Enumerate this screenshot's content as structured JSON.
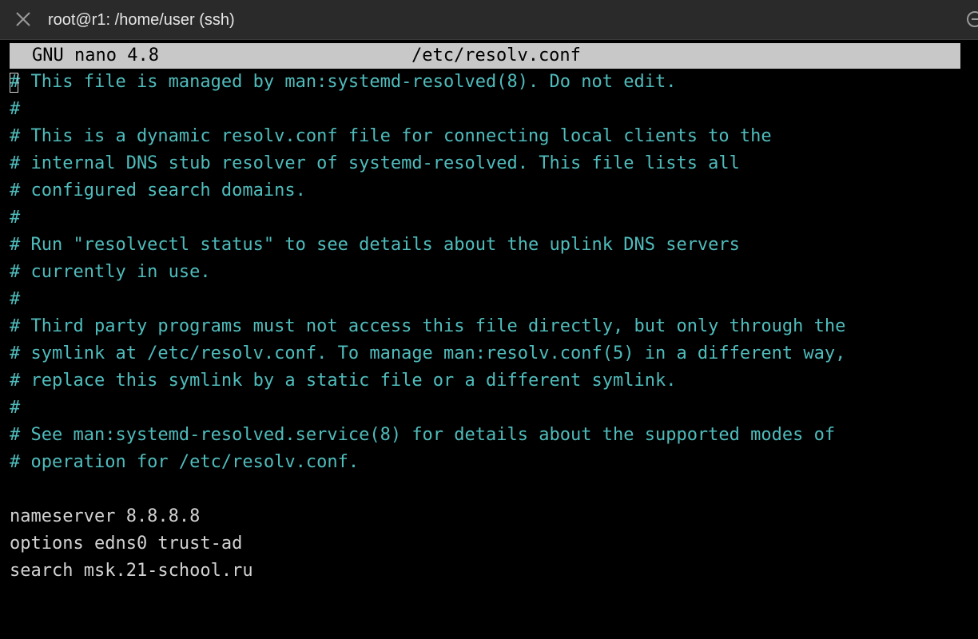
{
  "window": {
    "tab_title": "root@r1: /home/user (ssh)",
    "close_icon": "close-icon"
  },
  "nano": {
    "version": "GNU nano 4.8",
    "filename": "/etc/resolv.conf"
  },
  "colors": {
    "comment": "#50bcbc",
    "text": "#d2d2d2",
    "titlebar_bg": "#c8c8c8",
    "background": "#000000"
  },
  "file": {
    "lines": [
      {
        "text": "# This file is managed by man:systemd-resolved(8). Do not edit.",
        "kind": "comment"
      },
      {
        "text": "#",
        "kind": "comment"
      },
      {
        "text": "# This is a dynamic resolv.conf file for connecting local clients to the",
        "kind": "comment"
      },
      {
        "text": "# internal DNS stub resolver of systemd-resolved. This file lists all",
        "kind": "comment"
      },
      {
        "text": "# configured search domains.",
        "kind": "comment"
      },
      {
        "text": "#",
        "kind": "comment"
      },
      {
        "text": "# Run \"resolvectl status\" to see details about the uplink DNS servers",
        "kind": "comment"
      },
      {
        "text": "# currently in use.",
        "kind": "comment"
      },
      {
        "text": "#",
        "kind": "comment"
      },
      {
        "text": "# Third party programs must not access this file directly, but only through the",
        "kind": "comment"
      },
      {
        "text": "# symlink at /etc/resolv.conf. To manage man:resolv.conf(5) in a different way,",
        "kind": "comment"
      },
      {
        "text": "# replace this symlink by a static file or a different symlink.",
        "kind": "comment"
      },
      {
        "text": "#",
        "kind": "comment"
      },
      {
        "text": "# See man:systemd-resolved.service(8) for details about the supported modes of",
        "kind": "comment"
      },
      {
        "text": "# operation for /etc/resolv.conf.",
        "kind": "comment"
      },
      {
        "text": "",
        "kind": "text"
      },
      {
        "text": "nameserver 8.8.8.8",
        "kind": "text"
      },
      {
        "text": "options edns0 trust-ad",
        "kind": "text"
      },
      {
        "text": "search msk.21-school.ru",
        "kind": "text"
      }
    ],
    "cursor": {
      "line": 0,
      "column": 0
    }
  }
}
